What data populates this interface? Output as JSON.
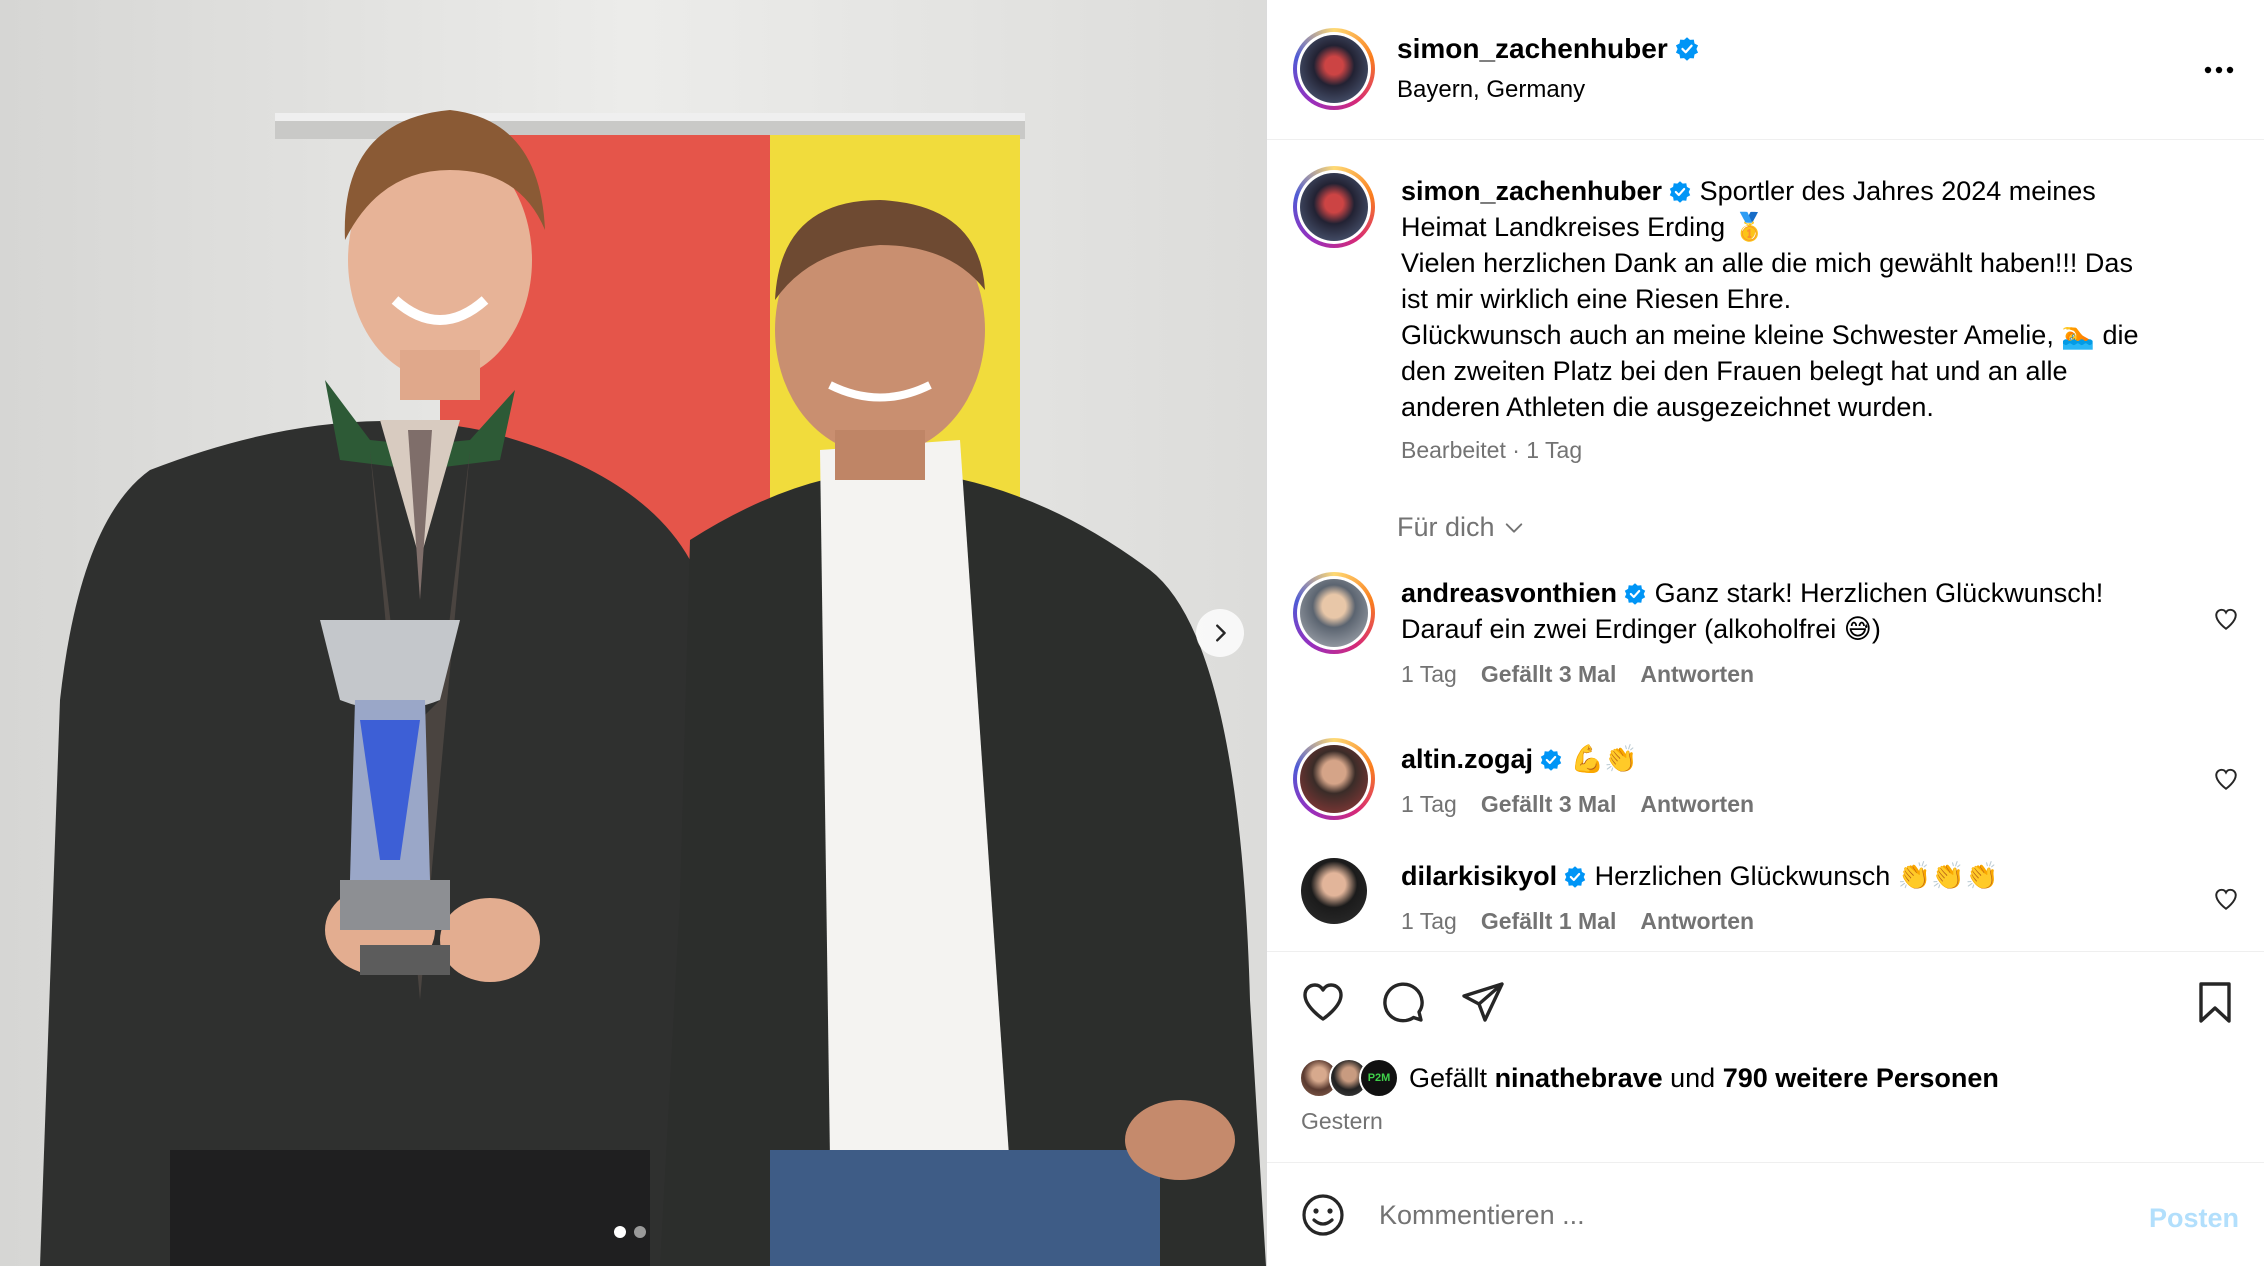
{
  "post": {
    "username": "simon_zachenhuber",
    "location": "Bayern, Germany",
    "caption": {
      "lines": [
        "Sportler des Jahres 2024 meines",
        "Heimat Landkreises Erding 🥇",
        "Vielen herzlichen Dank an alle die mich gewählt haben!!! Das",
        "ist mir wirklich eine Riesen Ehre.",
        "Glückwunsch auch an meine kleine Schwester Amelie, 🏊 die",
        "den zweiten Platz bei den Frauen belegt hat und an alle",
        "anderen Athleten die ausgezeichnet wurden."
      ],
      "meta": "Bearbeitet · 1 Tag"
    },
    "sort_label": "Für dich"
  },
  "comments": [
    {
      "username": "andreasvonthien",
      "lines": [
        "Ganz stark! Herzlichen Glückwunsch!",
        "Darauf ein zwei Erdinger (alkoholfrei 😅)"
      ],
      "time": "1 Tag",
      "likes": "Gefällt 3 Mal",
      "reply": "Antworten"
    },
    {
      "username": "altin.zogaj",
      "lines": [
        "💪👏"
      ],
      "time": "1 Tag",
      "likes": "Gefällt 3 Mal",
      "reply": "Antworten"
    },
    {
      "username": "dilarkisikyol",
      "lines": [
        "Herzlichen Glückwunsch 👏👏👏"
      ],
      "time": "1 Tag",
      "likes": "Gefällt 1 Mal",
      "reply": "Antworten"
    }
  ],
  "likes": {
    "prefix": "Gefällt",
    "user": "ninathebrave",
    "middle": "und",
    "others": "790 weitere Personen",
    "date": "Gestern"
  },
  "composer": {
    "placeholder": "Kommentieren ...",
    "post_label": "Posten"
  },
  "carousel": {
    "current": 1,
    "total": 2
  },
  "icons": [
    "verified-icon",
    "more-icon",
    "chevron-down-icon",
    "heart-icon",
    "comment-icon",
    "share-icon",
    "bookmark-icon",
    "emoji-icon",
    "chevron-right-icon"
  ],
  "colors": {
    "verified": "#0095f6",
    "post_disabled": "#b2dffc",
    "meta_gray": "#737373"
  }
}
